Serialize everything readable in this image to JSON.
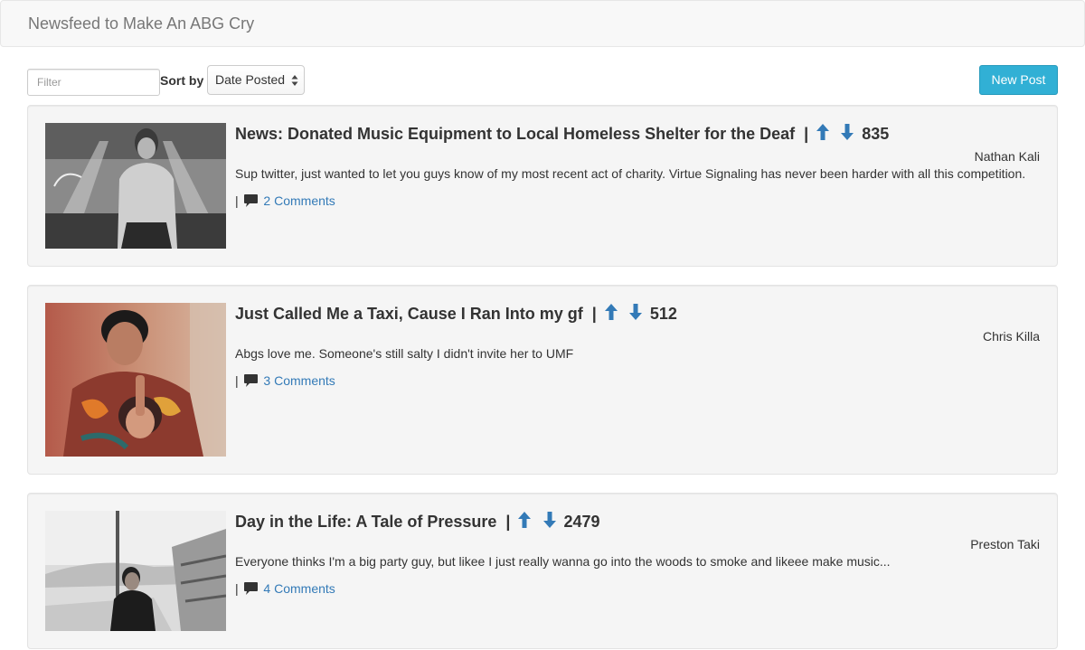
{
  "header": {
    "brand": "Newsfeed to Make An ABG Cry"
  },
  "toolbar": {
    "filter_placeholder": "Filter",
    "sort_label": "Sort by",
    "sort_selected": "Date Posted",
    "new_post_label": "New Post"
  },
  "colors": {
    "accent": "#31b0d5",
    "link": "#337ab7",
    "vote_arrow": "#337ab7",
    "card_bg": "#f5f5f5"
  },
  "posts": [
    {
      "title": "News: Donated Music Equipment to Local Homeless Shelter for the Deaf",
      "separator": "|",
      "score": "835",
      "author": "Nathan Kali",
      "body": "Sup twitter, just wanted to let you guys know of my most recent act of charity. Virtue Signaling has never been harder with all this competition.",
      "comments_label": "2 Comments",
      "pipe": "|",
      "image": "grayscale-portrait-hoodie"
    },
    {
      "title": "Just Called Me a Taxi, Cause I Ran Into my gf",
      "separator": "|",
      "score": "512",
      "author": "Chris Killa",
      "body": "Abgs love me. Someone's still salty I didn't invite her to UMF",
      "comments_label": "3 Comments",
      "pipe": "|",
      "image": "color-portrait-praying-hands"
    },
    {
      "title": "Day in the Life: A Tale of Pressure",
      "separator": "|",
      "score": "2479",
      "author": "Preston Taki",
      "body": "Everyone thinks I'm a big party guy, but likee I just really wanna go into the woods to smoke and likeee make music...",
      "comments_label": "4 Comments",
      "pipe": "|",
      "image": "grayscale-portrait-bridge"
    }
  ],
  "icons": {
    "upvote": "arrow-up-icon",
    "downvote": "arrow-down-icon",
    "comment": "comment-icon",
    "select_caret": "select-caret-icon"
  }
}
